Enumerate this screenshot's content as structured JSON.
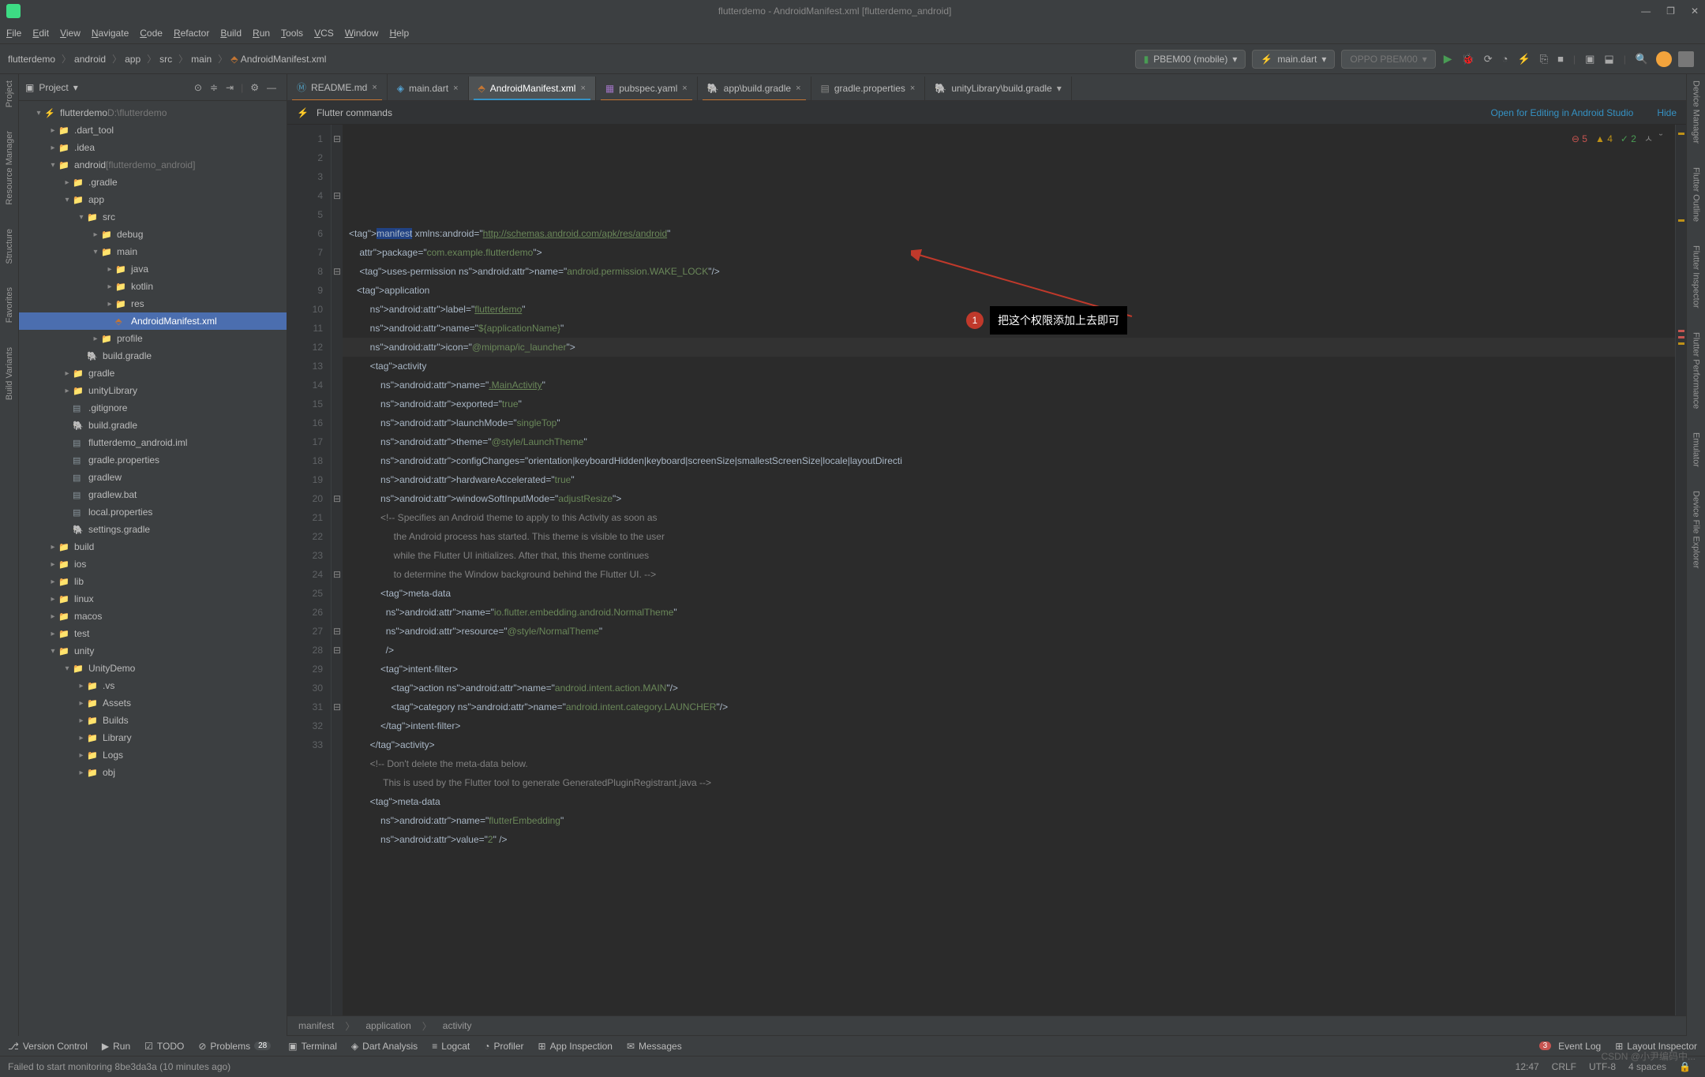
{
  "title": "flutterdemo - AndroidManifest.xml [flutterdemo_android]",
  "menu": [
    "File",
    "Edit",
    "View",
    "Navigate",
    "Code",
    "Refactor",
    "Build",
    "Run",
    "Tools",
    "VCS",
    "Window",
    "Help"
  ],
  "breadcrumb": [
    "flutterdemo",
    "android",
    "app",
    "src",
    "main",
    "AndroidManifest.xml"
  ],
  "device": "PBEM00 (mobile)",
  "run_config": "main.dart",
  "emulator": "OPPO PBEM00",
  "project_label": "Project",
  "left_tools": [
    "Project",
    "Resource Manager",
    "Structure",
    "Favorites",
    "Build Variants"
  ],
  "right_tools": [
    "Device Manager",
    "Flutter Outline",
    "Flutter Inspector",
    "Flutter Performance",
    "Emulator",
    "Device File Explorer"
  ],
  "tree": [
    {
      "d": 0,
      "a": "▾",
      "i": "fl",
      "t": "flutterdemo",
      "suffix": "D:\\flutterdemo"
    },
    {
      "d": 1,
      "a": "▸",
      "i": "folder",
      "t": ".dart_tool"
    },
    {
      "d": 1,
      "a": "▸",
      "i": "folder",
      "t": ".idea"
    },
    {
      "d": 1,
      "a": "▾",
      "i": "folder",
      "t": "android",
      "suffix": "[flutterdemo_android]"
    },
    {
      "d": 2,
      "a": "▸",
      "i": "folder",
      "t": ".gradle"
    },
    {
      "d": 2,
      "a": "▾",
      "i": "folder",
      "t": "app"
    },
    {
      "d": 3,
      "a": "▾",
      "i": "folder",
      "t": "src"
    },
    {
      "d": 4,
      "a": "▸",
      "i": "folder",
      "t": "debug"
    },
    {
      "d": 4,
      "a": "▾",
      "i": "folder",
      "t": "main"
    },
    {
      "d": 5,
      "a": "▸",
      "i": "folder-b",
      "t": "java"
    },
    {
      "d": 5,
      "a": "▸",
      "i": "folder-b",
      "t": "kotlin"
    },
    {
      "d": 5,
      "a": "▸",
      "i": "folder",
      "t": "res"
    },
    {
      "d": 5,
      "a": "",
      "i": "xml",
      "t": "AndroidManifest.xml",
      "sel": true
    },
    {
      "d": 4,
      "a": "▸",
      "i": "folder",
      "t": "profile"
    },
    {
      "d": 3,
      "a": "",
      "i": "gradle",
      "t": "build.gradle"
    },
    {
      "d": 2,
      "a": "▸",
      "i": "folder",
      "t": "gradle"
    },
    {
      "d": 2,
      "a": "▸",
      "i": "folder",
      "t": "unityLibrary"
    },
    {
      "d": 2,
      "a": "",
      "i": "file",
      "t": ".gitignore"
    },
    {
      "d": 2,
      "a": "",
      "i": "gradle",
      "t": "build.gradle"
    },
    {
      "d": 2,
      "a": "",
      "i": "file",
      "t": "flutterdemo_android.iml"
    },
    {
      "d": 2,
      "a": "",
      "i": "file",
      "t": "gradle.properties"
    },
    {
      "d": 2,
      "a": "",
      "i": "file",
      "t": "gradlew"
    },
    {
      "d": 2,
      "a": "",
      "i": "file",
      "t": "gradlew.bat"
    },
    {
      "d": 2,
      "a": "",
      "i": "file",
      "t": "local.properties"
    },
    {
      "d": 2,
      "a": "",
      "i": "gradle",
      "t": "settings.gradle"
    },
    {
      "d": 1,
      "a": "▸",
      "i": "folder-x",
      "t": "build"
    },
    {
      "d": 1,
      "a": "▸",
      "i": "folder",
      "t": "ios"
    },
    {
      "d": 1,
      "a": "▸",
      "i": "folder",
      "t": "lib"
    },
    {
      "d": 1,
      "a": "▸",
      "i": "folder",
      "t": "linux"
    },
    {
      "d": 1,
      "a": "▸",
      "i": "folder",
      "t": "macos"
    },
    {
      "d": 1,
      "a": "▸",
      "i": "folder-t",
      "t": "test"
    },
    {
      "d": 1,
      "a": "▾",
      "i": "folder",
      "t": "unity"
    },
    {
      "d": 2,
      "a": "▾",
      "i": "folder",
      "t": "UnityDemo"
    },
    {
      "d": 3,
      "a": "▸",
      "i": "folder",
      "t": ".vs"
    },
    {
      "d": 3,
      "a": "▸",
      "i": "folder",
      "t": "Assets"
    },
    {
      "d": 3,
      "a": "▸",
      "i": "folder",
      "t": "Builds"
    },
    {
      "d": 3,
      "a": "▸",
      "i": "folder",
      "t": "Library"
    },
    {
      "d": 3,
      "a": "▸",
      "i": "folder",
      "t": "Logs"
    },
    {
      "d": 3,
      "a": "▸",
      "i": "folder",
      "t": "obj"
    }
  ],
  "tabs": [
    {
      "label": "README.md",
      "icon": "md",
      "warn": true
    },
    {
      "label": "main.dart",
      "icon": "dart"
    },
    {
      "label": "AndroidManifest.xml",
      "icon": "xml",
      "active": true
    },
    {
      "label": "pubspec.yaml",
      "icon": "yaml",
      "warn": true
    },
    {
      "label": "app\\build.gradle",
      "icon": "gradle",
      "warn": true
    },
    {
      "label": "gradle.properties",
      "icon": "file"
    },
    {
      "label": "unityLibrary\\build.gradle",
      "icon": "gradle",
      "more": true
    }
  ],
  "flutter_commands": "Flutter commands",
  "open_link": "Open for Editing in Android Studio",
  "hide_link": "Hide",
  "inspection": {
    "errors": "5",
    "warnings": "4",
    "ok": "2"
  },
  "annotation": {
    "num": "1",
    "text": "把这个权限添加上去即可"
  },
  "code_breadcrumb": [
    "manifest",
    "application",
    "activity"
  ],
  "bottom_tools": [
    "Version Control",
    "Run",
    "TODO",
    "Problems",
    "Terminal",
    "Dart Analysis",
    "Logcat",
    "Profiler",
    "App Inspection",
    "Messages"
  ],
  "problems_count": "28",
  "event_log": "Event Log",
  "event_count": "3",
  "layout_inspector": "Layout Inspector",
  "status_msg": "Failed to start monitoring 8be3da3a (10 minutes ago)",
  "status_right": {
    "time": "12:47",
    "crlf": "CRLF",
    "enc": "UTF-8",
    "indent": "4 spaces"
  },
  "watermark": "CSDN @小尹编码中...",
  "code_lines": [
    "<manifest xmlns:android=\"http://schemas.android.com/apk/res/android\"",
    "    package=\"com.example.flutterdemo\">",
    "    <uses-permission android:name=\"android.permission.WAKE_LOCK\"/>",
    "   <application",
    "        android:label=\"flutterdemo\"",
    "        android:name=\"${applicationName}\"",
    "        android:icon=\"@mipmap/ic_launcher\">",
    "        <activity",
    "            android:name=\".MainActivity\"",
    "            android:exported=\"true\"",
    "            android:launchMode=\"singleTop\"",
    "            android:theme=\"@style/LaunchTheme\"",
    "            android:configChanges=\"orientation|keyboardHidden|keyboard|screenSize|smallestScreenSize|locale|layoutDirecti",
    "            android:hardwareAccelerated=\"true\"",
    "            android:windowSoftInputMode=\"adjustResize\">",
    "            <!-- Specifies an Android theme to apply to this Activity as soon as",
    "                 the Android process has started. This theme is visible to the user",
    "                 while the Flutter UI initializes. After that, this theme continues",
    "                 to determine the Window background behind the Flutter UI. -->",
    "            <meta-data",
    "              android:name=\"io.flutter.embedding.android.NormalTheme\"",
    "              android:resource=\"@style/NormalTheme\"",
    "              />",
    "            <intent-filter>",
    "                <action android:name=\"android.intent.action.MAIN\"/>",
    "                <category android:name=\"android.intent.category.LAUNCHER\"/>",
    "            </intent-filter>",
    "        </activity>",
    "        <!-- Don't delete the meta-data below.",
    "             This is used by the Flutter tool to generate GeneratedPluginRegistrant.java -->",
    "        <meta-data",
    "            android:name=\"flutterEmbedding\"",
    "            android:value=\"2\" />"
  ],
  "current_line": 12
}
